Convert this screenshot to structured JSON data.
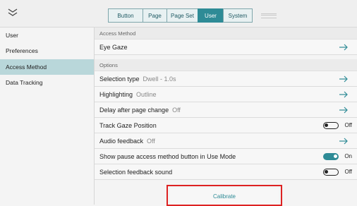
{
  "topbar": {
    "tabs": [
      {
        "label": "Button",
        "active": false
      },
      {
        "label": "Page",
        "active": false
      },
      {
        "label": "Page Set",
        "active": false
      },
      {
        "label": "User",
        "active": true
      },
      {
        "label": "System",
        "active": false
      }
    ],
    "accent_color": "#2e8b96"
  },
  "sidebar": {
    "items": [
      {
        "label": "User",
        "active": false
      },
      {
        "label": "Preferences",
        "active": false
      },
      {
        "label": "Access Method",
        "active": true
      },
      {
        "label": "Data Tracking",
        "active": false
      }
    ]
  },
  "main": {
    "access_method_header": "Access Method",
    "access_method_value": "Eye Gaze",
    "options_header": "Options",
    "options": [
      {
        "label": "Selection type",
        "value": "Dwell - 1.0s",
        "control": "arrow"
      },
      {
        "label": "Highlighting",
        "value": "Outline",
        "control": "arrow"
      },
      {
        "label": "Delay after page change",
        "value": "Off",
        "control": "arrow"
      },
      {
        "label": "Track Gaze Position",
        "value": "",
        "control": "toggle",
        "state": "Off"
      },
      {
        "label": "Audio feedback",
        "value": "Off",
        "control": "arrow"
      },
      {
        "label": "Show pause access method button in Use Mode",
        "value": "",
        "control": "toggle",
        "state": "On"
      },
      {
        "label": "Selection feedback sound",
        "value": "",
        "control": "toggle",
        "state": "Off"
      }
    ],
    "calibrate_label": "Calibrate"
  }
}
